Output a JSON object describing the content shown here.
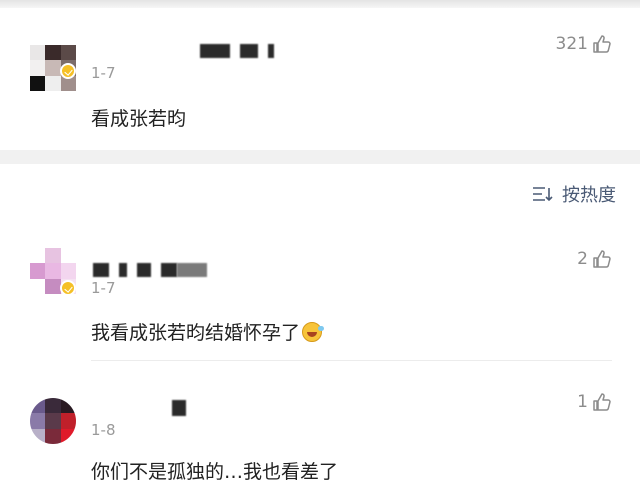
{
  "hot_comment": {
    "date": "1-7",
    "text": "看成张若昀",
    "likes": "321"
  },
  "sort": {
    "label": "按热度",
    "icon": "sort-icon"
  },
  "comments": [
    {
      "date": "1-7",
      "text": "我看成张若昀结婚怀孕了",
      "likes": "2",
      "emoji": "laugh-cry-emoji"
    },
    {
      "date": "1-8",
      "text": "你们不是孤独的…我也看差了",
      "likes": "1"
    }
  ],
  "icons": {
    "like": "thumbs-up-icon",
    "verified": "verified-badge-icon"
  },
  "colors": {
    "badge": "#f5c027",
    "sort_text": "#4a5a75",
    "meta_text": "#9a9a9a"
  }
}
